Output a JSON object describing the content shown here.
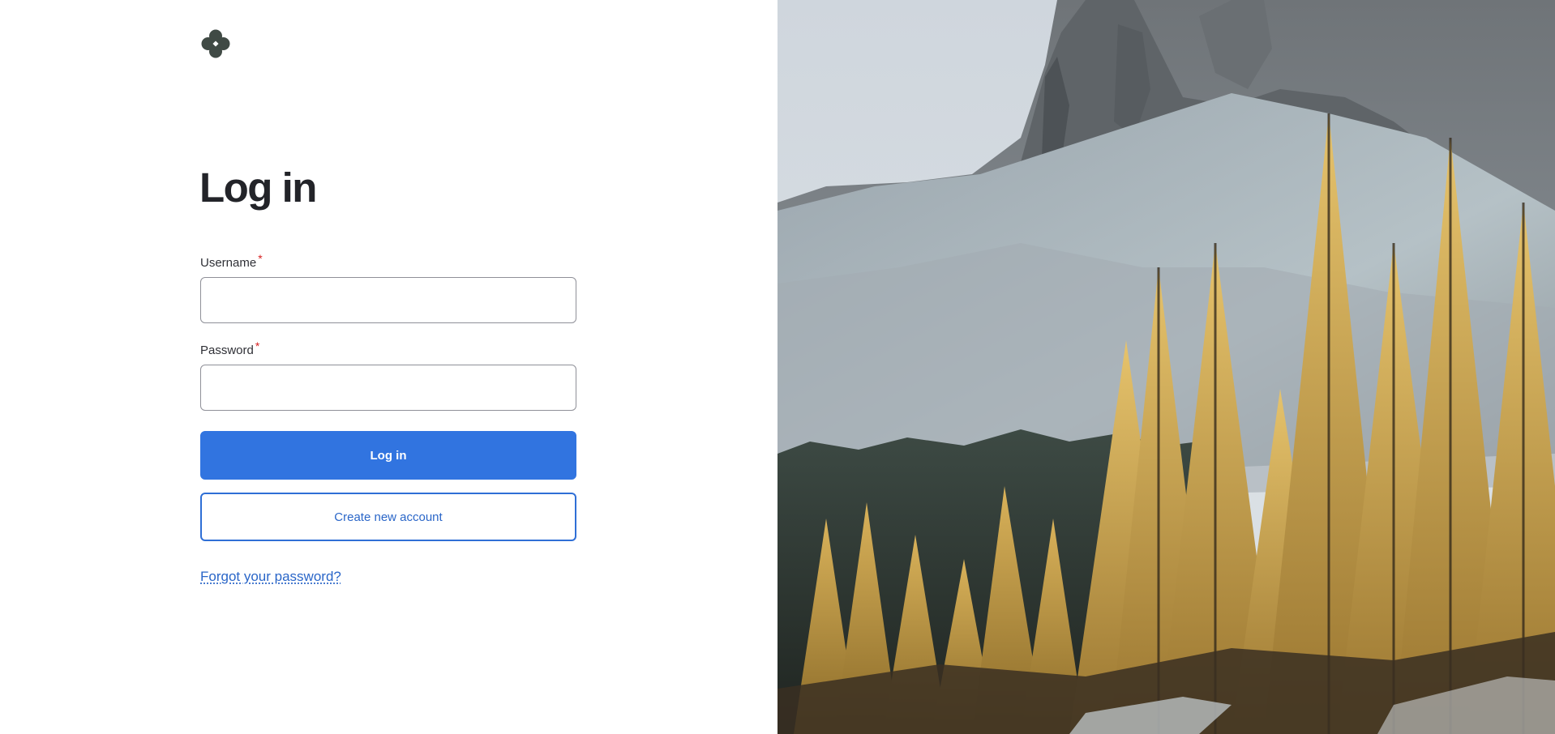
{
  "page": {
    "title": "Log in"
  },
  "logo": {
    "icon": "clover-logo-icon",
    "color": "#404a45"
  },
  "form": {
    "username": {
      "label": "Username",
      "required_mark": "*",
      "value": "",
      "placeholder": ""
    },
    "password": {
      "label": "Password",
      "required_mark": "*",
      "value": "",
      "placeholder": ""
    },
    "login_button": "Log in",
    "create_account_button": "Create new account",
    "forgot_password_link": "Forgot your password?"
  },
  "colors": {
    "primary": "#3174e0",
    "link": "#2a66c8",
    "required": "#d72222",
    "text": "#232429"
  },
  "hero_image": {
    "subject": "mountain-and-larch-trees-image"
  }
}
